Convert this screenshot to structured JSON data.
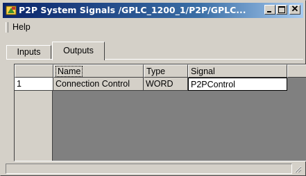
{
  "window": {
    "title": "P2P System Signals /GPLC_1200_1/P2P/GPLC..."
  },
  "menubar": {
    "help_label": "Help"
  },
  "tabs": [
    {
      "label": "Inputs"
    },
    {
      "label": "Outputs"
    }
  ],
  "grid": {
    "columns": [
      {
        "label": ""
      },
      {
        "label": "Name"
      },
      {
        "label": "Type"
      },
      {
        "label": "Signal"
      }
    ],
    "rows": [
      {
        "index": "1",
        "name": "Connection Control",
        "type": "WORD",
        "signal": "P2PControl"
      }
    ]
  },
  "icons": {
    "app": "app-window-icon",
    "minimize": "minimize-icon",
    "maximize": "maximize-icon",
    "close": "close-icon",
    "size_grip": "size-grip-icon"
  },
  "colors": {
    "title_start": "#0a246a",
    "title_end": "#a6caf0",
    "face": "#d4d0c8",
    "grid_background": "#808080"
  }
}
